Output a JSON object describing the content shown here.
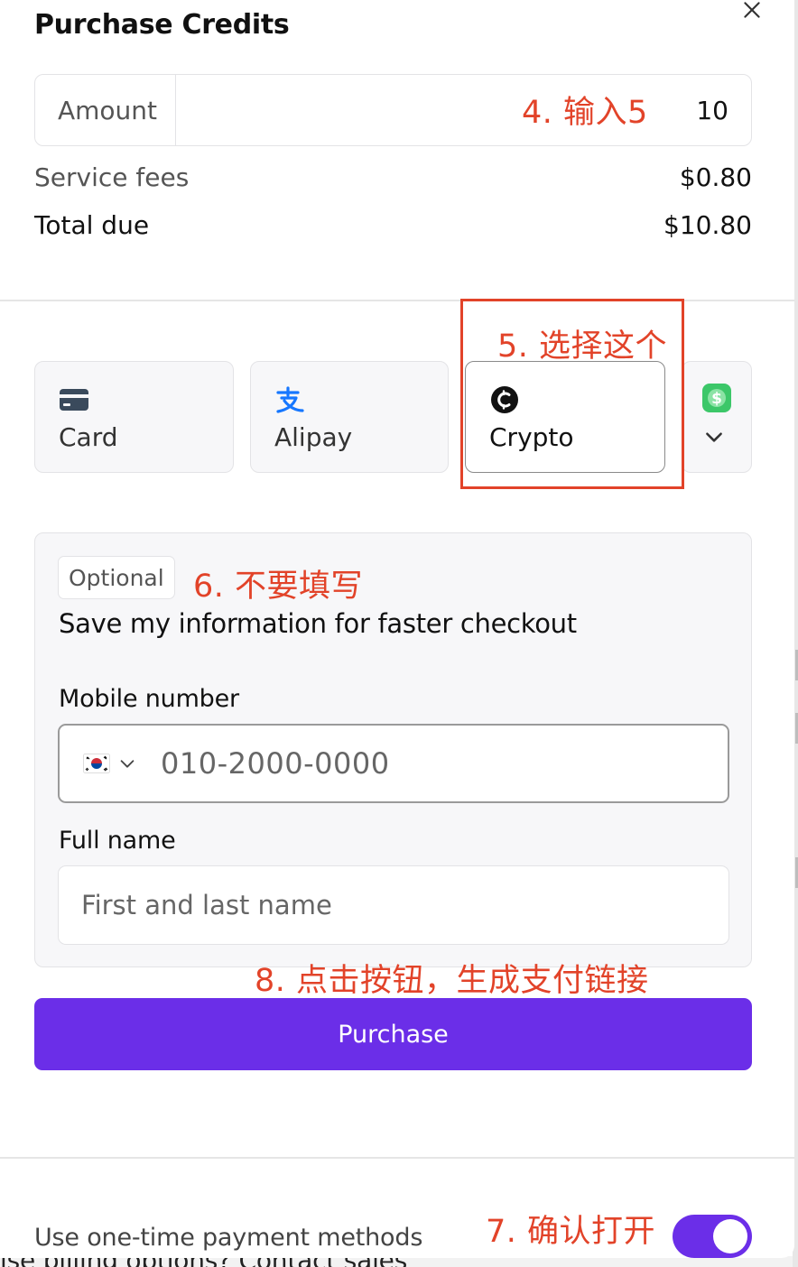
{
  "modal": {
    "title": "Purchase Credits"
  },
  "amount": {
    "label": "Amount",
    "value": "10"
  },
  "fees": {
    "service_label": "Service fees",
    "service_value": "$0.80",
    "total_label": "Total due",
    "total_value": "$10.80"
  },
  "payment_methods": [
    {
      "label": "Card",
      "icon": "credit-card-icon"
    },
    {
      "label": "Alipay",
      "icon": "alipay-icon"
    },
    {
      "label": "Crypto",
      "icon": "crypto-coin-icon",
      "selected": true
    },
    {
      "label": "",
      "icon": "cash-app-icon"
    }
  ],
  "form": {
    "badge": "Optional",
    "save_text": "Save my information for faster checkout",
    "mobile_label": "Mobile number",
    "mobile_placeholder": "010-2000-0000",
    "name_label": "Full name",
    "name_placeholder": "First and last name"
  },
  "purchase_button": "Purchase",
  "one_time": {
    "label": "Use one-time payment methods",
    "enabled": true
  },
  "background_text": {
    "prefix": "ise billing options? ",
    "link": "Contact sales"
  },
  "annotations": {
    "step4": "4. 输入5",
    "step5": "5. 选择这个",
    "step6": "6. 不要填写",
    "step7": "7. 确认打开",
    "step8": "8. 点击按钮，生成支付链接"
  },
  "colors": {
    "accent": "#6b2ee8",
    "annotation": "#e24329",
    "cash_app": "#3cc769",
    "alipay": "#1677ff"
  }
}
